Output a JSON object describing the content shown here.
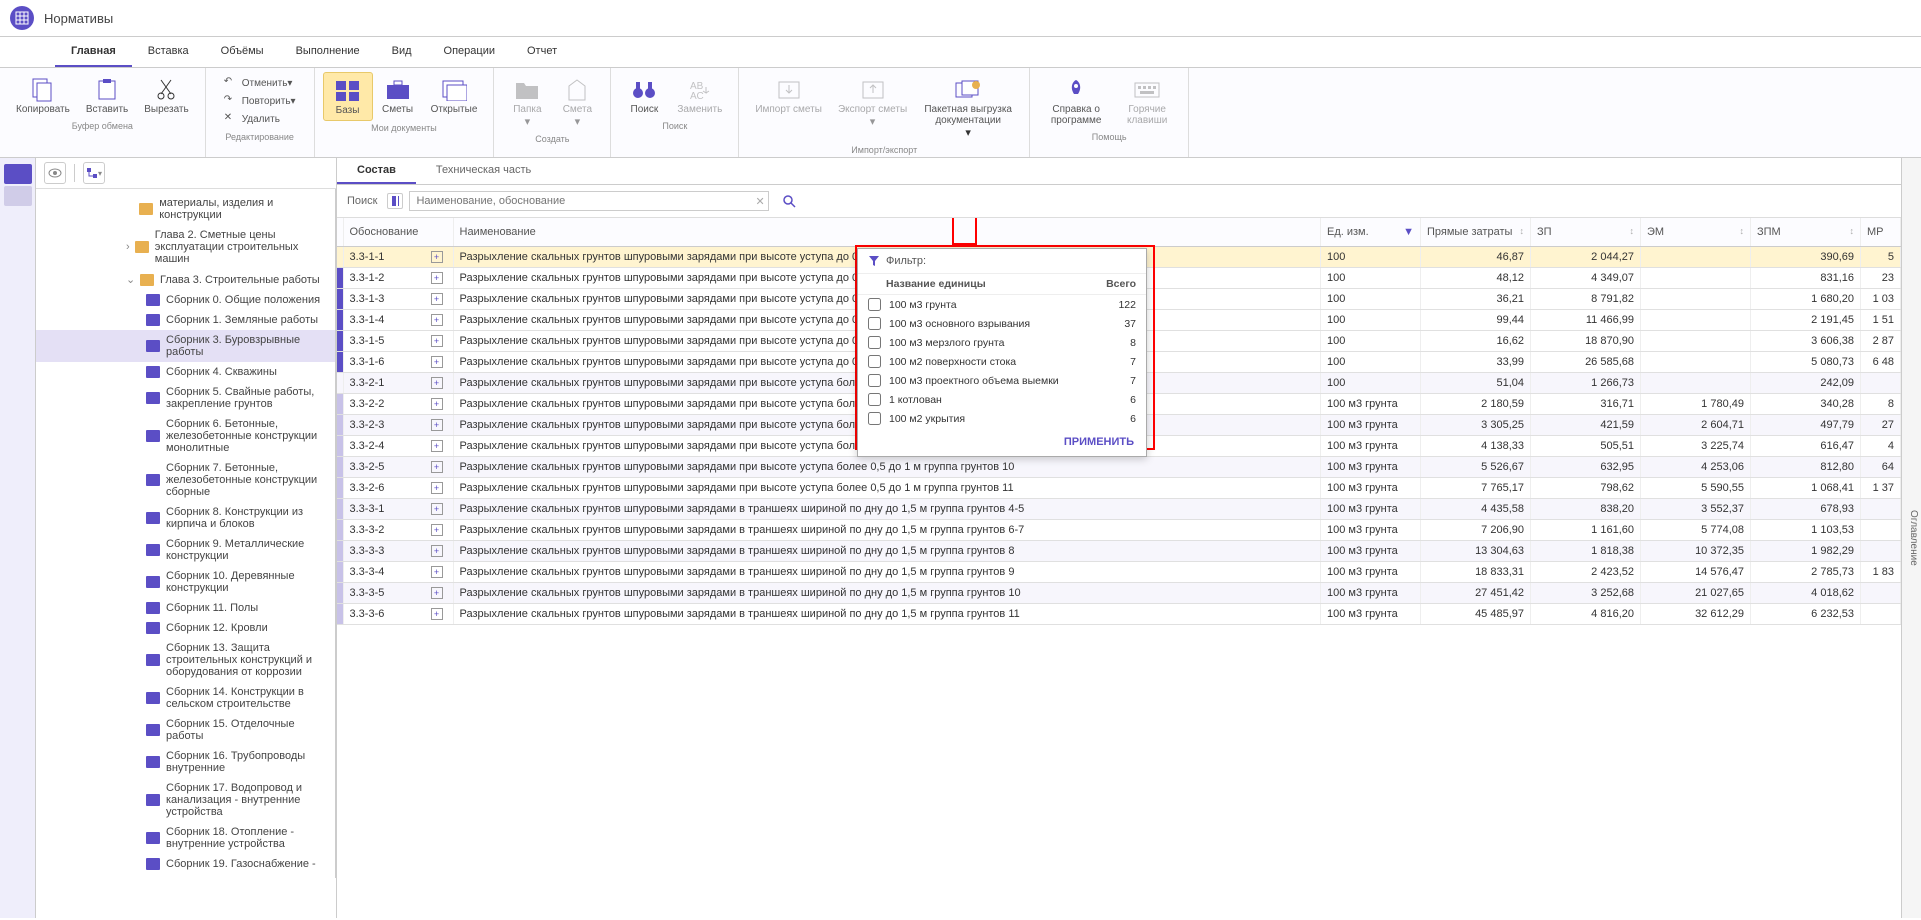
{
  "app": {
    "title": "Нормативы"
  },
  "menu": {
    "tabs": [
      "Главная",
      "Вставка",
      "Объёмы",
      "Выполнение",
      "Вид",
      "Операции",
      "Отчет"
    ],
    "activeIndex": 0
  },
  "ribbon": {
    "clipboard": {
      "label": "Буфер обмена",
      "copy": "Копировать",
      "paste": "Вставить",
      "cut": "Вырезать"
    },
    "editing": {
      "label": "Редактирование",
      "undo": "Отменить",
      "redo": "Повторить",
      "delete": "Удалить"
    },
    "mydocs": {
      "label": "Мои документы",
      "bases": "Базы",
      "estimates": "Сметы",
      "open": "Открытые"
    },
    "create": {
      "label": "Создать",
      "folder": "Папка",
      "estimate": "Смета"
    },
    "search": {
      "label": "Поиск",
      "search": "Поиск",
      "replace": "Заменить"
    },
    "importexport": {
      "label": "Импорт/экспорт",
      "import": "Импорт сметы",
      "export": "Экспорт сметы",
      "batch": "Пакетная выгрузка документации"
    },
    "help": {
      "label": "Помощь",
      "about": "Справка о программе",
      "hotkeys": "Горячие клавиши"
    }
  },
  "content_tabs": {
    "items": [
      "Состав",
      "Техническая часть"
    ],
    "activeIndex": 0
  },
  "search": {
    "label": "Поиск",
    "placeholder": "Наименование, обоснование"
  },
  "rightbar": {
    "label": "Оглавление"
  },
  "tree": [
    {
      "level": 0,
      "icon": "folder",
      "chev": "",
      "text": "материалы, изделия и конструкции"
    },
    {
      "level": 0,
      "icon": "folder",
      "chev": ">",
      "text": "Глава 2. Сметные цены эксплуатации строительных машин"
    },
    {
      "level": 0,
      "icon": "folder",
      "chev": "v",
      "text": "Глава  3. Строительные работы"
    },
    {
      "level": 1,
      "icon": "book",
      "text": "Сборник  0. Общие положения"
    },
    {
      "level": 1,
      "icon": "book",
      "text": "Сборник  1. Земляные работы"
    },
    {
      "level": 1,
      "icon": "book",
      "text": "Сборник  3. Буровзрывные работы",
      "selected": true
    },
    {
      "level": 1,
      "icon": "book",
      "text": "Сборник  4. Скважины"
    },
    {
      "level": 1,
      "icon": "book",
      "text": "Сборник  5. Свайные работы, закрепление грунтов"
    },
    {
      "level": 1,
      "icon": "book",
      "text": "Сборник  6. Бетонные, железобетонные конструкции монолитные"
    },
    {
      "level": 1,
      "icon": "book",
      "text": "Сборник  7. Бетонные, железобетонные конструкции сборные"
    },
    {
      "level": 1,
      "icon": "book",
      "text": "Сборник  8. Конструкции из кирпича и блоков"
    },
    {
      "level": 1,
      "icon": "book",
      "text": "Сборник  9. Металлические конструкции"
    },
    {
      "level": 1,
      "icon": "book",
      "text": "Сборник 10. Деревянные конструкции"
    },
    {
      "level": 1,
      "icon": "book",
      "text": "Сборник 11. Полы"
    },
    {
      "level": 1,
      "icon": "book",
      "text": "Сборник 12. Кровли"
    },
    {
      "level": 1,
      "icon": "book",
      "text": "Сборник 13. Защита строительных конструкций и оборудования от коррозии"
    },
    {
      "level": 1,
      "icon": "book",
      "text": "Сборник 14. Конструкции в сельском строительстве"
    },
    {
      "level": 1,
      "icon": "book",
      "text": "Сборник 15. Отделочные работы"
    },
    {
      "level": 1,
      "icon": "book",
      "text": "Сборник 16. Трубопроводы внутренние"
    },
    {
      "level": 1,
      "icon": "book",
      "text": "Сборник 17. Водопровод и канализация - внутренние устройства"
    },
    {
      "level": 1,
      "icon": "book",
      "text": "Сборник 18. Отопление - внутренние устройства"
    },
    {
      "level": 1,
      "icon": "book",
      "text": "Сборник 19. Газоснабжение -"
    }
  ],
  "columns": {
    "just": "Обоснование",
    "name": "Наименование",
    "unit": "Ед. изм.",
    "direct": "Прямые затраты",
    "zp": "ЗП",
    "em": "ЭМ",
    "zpm": "ЗПМ",
    "mr": "МР"
  },
  "rows": [
    {
      "just": "3.3-1-1",
      "name": "Разрыхление скальных грунтов шпуровыми зарядами при высоте уступа до 0,5 м (планировка поверхности) группа грунтов 4-5",
      "unit": "100",
      "direct": "46,87",
      "zp": "2 044,27",
      "em": "",
      "zpm": "390,69",
      "mr": "5",
      "hl": true
    },
    {
      "just": "3.3-1-2",
      "name": "Разрыхление скальных грунтов шпуровыми зарядами при высоте уступа до 0,5 м (планировка поверхности) группа грунтов 6-7",
      "unit": "100",
      "direct": "48,12",
      "zp": "4 349,07",
      "em": "",
      "zpm": "831,16",
      "mr": "23"
    },
    {
      "just": "3.3-1-3",
      "name": "Разрыхление скальных грунтов шпуровыми зарядами при высоте уступа до 0,5 м (планировка поверхности) группа грунтов 8",
      "unit": "100",
      "direct": "36,21",
      "zp": "8 791,82",
      "em": "",
      "zpm": "1 680,20",
      "mr": "1 03"
    },
    {
      "just": "3.3-1-4",
      "name": "Разрыхление скальных грунтов шпуровыми зарядами при высоте уступа до 0,5 м (планировка поверхности) группа грунтов 9",
      "unit": "100",
      "direct": "99,44",
      "zp": "11 466,99",
      "em": "",
      "zpm": "2 191,45",
      "mr": "1 51"
    },
    {
      "just": "3.3-1-5",
      "name": "Разрыхление скальных грунтов шпуровыми зарядами при высоте уступа до 0,5 м (планировка поверхности) группа грунтов 10",
      "unit": "100",
      "direct": "16,62",
      "zp": "18 870,90",
      "em": "",
      "zpm": "3 606,38",
      "mr": "2 87"
    },
    {
      "just": "3.3-1-6",
      "name": "Разрыхление скальных грунтов шпуровыми зарядами при высоте уступа до 0,5 м (планировка поверхности) группа грунтов 11",
      "unit": "100",
      "direct": "33,99",
      "zp": "26 585,68",
      "em": "",
      "zpm": "5 080,73",
      "mr": "6 48"
    },
    {
      "just": "3.3-2-1",
      "name": "Разрыхление скальных грунтов шпуровыми зарядами при высоте уступа более 0,5 до 1 м группа грунтов 4-5",
      "unit": "100",
      "direct": "51,04",
      "zp": "1 266,73",
      "em": "",
      "zpm": "242,09",
      "mr": "",
      "alt": true
    },
    {
      "just": "3.3-2-2",
      "name": "Разрыхление скальных грунтов шпуровыми зарядами при высоте уступа более 0,5 до 1 м группа грунтов 6-7",
      "unit": "100 м3 грунта",
      "direct": "2 180,59",
      "zp": "316,71",
      "em": "1 780,49",
      "zpm": "340,28",
      "mr": "8"
    },
    {
      "just": "3.3-2-3",
      "name": "Разрыхление скальных грунтов шпуровыми зарядами при высоте уступа более 0,5 до 1 м группа грунтов 8",
      "unit": "100 м3 грунта",
      "direct": "3 305,25",
      "zp": "421,59",
      "em": "2 604,71",
      "zpm": "497,79",
      "mr": "27",
      "alt": true
    },
    {
      "just": "3.3-2-4",
      "name": "Разрыхление скальных грунтов шпуровыми зарядами при высоте уступа более 0,5 до 1 м группа грунтов 9",
      "unit": "100 м3 грунта",
      "direct": "4 138,33",
      "zp": "505,51",
      "em": "3 225,74",
      "zpm": "616,47",
      "mr": "4"
    },
    {
      "just": "3.3-2-5",
      "name": "Разрыхление скальных грунтов шпуровыми зарядами при высоте уступа более 0,5 до 1 м группа грунтов 10",
      "unit": "100 м3 грунта",
      "direct": "5 526,67",
      "zp": "632,95",
      "em": "4 253,06",
      "zpm": "812,80",
      "mr": "64",
      "alt": true
    },
    {
      "just": "3.3-2-6",
      "name": "Разрыхление скальных грунтов шпуровыми зарядами при высоте уступа более 0,5 до 1 м группа грунтов 11",
      "unit": "100 м3 грунта",
      "direct": "7 765,17",
      "zp": "798,62",
      "em": "5 590,55",
      "zpm": "1 068,41",
      "mr": "1 37"
    },
    {
      "just": "3.3-3-1",
      "name": "Разрыхление скальных грунтов шпуровыми зарядами в траншеях шириной по дну до 1,5 м группа грунтов 4-5",
      "unit": "100 м3 грунта",
      "direct": "4 435,58",
      "zp": "838,20",
      "em": "3 552,37",
      "zpm": "678,93",
      "mr": "",
      "alt": true
    },
    {
      "just": "3.3-3-2",
      "name": "Разрыхление скальных грунтов шпуровыми зарядами в траншеях шириной по дну до 1,5 м группа грунтов 6-7",
      "unit": "100 м3 грунта",
      "direct": "7 206,90",
      "zp": "1 161,60",
      "em": "5 774,08",
      "zpm": "1 103,53",
      "mr": ""
    },
    {
      "just": "3.3-3-3",
      "name": "Разрыхление скальных грунтов шпуровыми зарядами в траншеях шириной по дну до 1,5 м группа грунтов 8",
      "unit": "100 м3 грунта",
      "direct": "13 304,63",
      "zp": "1 818,38",
      "em": "10 372,35",
      "zpm": "1 982,29",
      "mr": "",
      "alt": true
    },
    {
      "just": "3.3-3-4",
      "name": "Разрыхление скальных грунтов шпуровыми зарядами в траншеях шириной по дну до 1,5 м группа грунтов 9",
      "unit": "100 м3 грунта",
      "direct": "18 833,31",
      "zp": "2 423,52",
      "em": "14 576,47",
      "zpm": "2 785,73",
      "mr": "1 83"
    },
    {
      "just": "3.3-3-5",
      "name": "Разрыхление скальных грунтов шпуровыми зарядами в траншеях шириной по дну до 1,5 м группа грунтов 10",
      "unit": "100 м3 грунта",
      "direct": "27 451,42",
      "zp": "3 252,68",
      "em": "21 027,65",
      "zpm": "4 018,62",
      "mr": "",
      "alt": true
    },
    {
      "just": "3.3-3-6",
      "name": "Разрыхление скальных грунтов шпуровыми зарядами в траншеях шириной по дну до 1,5 м группа грунтов 11",
      "unit": "100 м3 грунта",
      "direct": "45 485,97",
      "zp": "4 816,20",
      "em": "32 612,29",
      "zpm": "6 232,53",
      "mr": ""
    }
  ],
  "filter": {
    "title": "Фильтр:",
    "col_name": "Название единицы",
    "col_total": "Всего",
    "apply": "ПРИМЕНИТЬ",
    "items": [
      {
        "name": "100 м3 грунта",
        "count": "122"
      },
      {
        "name": "100 м3 основного взрывания",
        "count": "37"
      },
      {
        "name": "100 м3 мерзлого грунта",
        "count": "8"
      },
      {
        "name": "100 м2 поверхности стока",
        "count": "7"
      },
      {
        "name": "100 м3 проектного объема выемки",
        "count": "7"
      },
      {
        "name": "1 котлован",
        "count": "6"
      },
      {
        "name": "100 м2 укрытия",
        "count": "6"
      }
    ]
  }
}
